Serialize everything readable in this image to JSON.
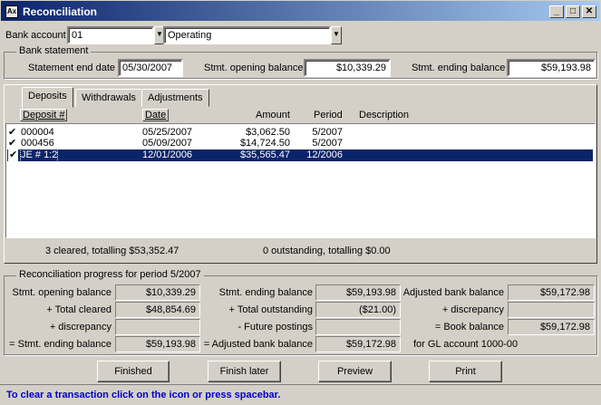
{
  "window": {
    "title": "Reconciliation",
    "icon": "app-icon",
    "icon_text": "Ax",
    "min_glyph": "_",
    "max_glyph": "□",
    "close_glyph": "✕"
  },
  "header": {
    "bank_account_label": "Bank account",
    "bank_account_code": "01",
    "bank_account_name": "Operating",
    "arrow": "▼"
  },
  "bank_statement": {
    "group_title": "Bank statement",
    "end_date_label": "Statement end date",
    "end_date": "05/30/2007",
    "opening_label": "Stmt. opening balance",
    "opening_value": "$10,339.29",
    "ending_label": "Stmt. ending balance",
    "ending_value": "$59,193.98"
  },
  "tabs": [
    {
      "label": "Deposits",
      "active": true
    },
    {
      "label": "Withdrawals",
      "active": false
    },
    {
      "label": "Adjustments",
      "active": false
    }
  ],
  "table": {
    "columns": [
      "Deposit #",
      "Date",
      "Amount",
      "Period",
      "Description"
    ],
    "rows": [
      {
        "check": "✔",
        "deposit": "000004",
        "date": "05/25/2007",
        "amount": "$3,062.50",
        "period": "5/2007",
        "description": "",
        "selected": false
      },
      {
        "check": "✔",
        "deposit": "000456",
        "date": "05/09/2007",
        "amount": "$14,724.50",
        "period": "5/2007",
        "description": "",
        "selected": false
      },
      {
        "check": "✔",
        "deposit": "JE # 1:2",
        "date": "12/01/2006",
        "amount": "$35,565.47",
        "period": "12/2006",
        "description": "",
        "selected": true
      }
    ]
  },
  "summary": {
    "cleared": "3 cleared, totalling $53,352.47",
    "outstanding": "0 outstanding, totalling $0.00"
  },
  "progress": {
    "group_title": "Reconciliation progress for period  5/2007",
    "col1": [
      {
        "label": "Stmt. opening balance",
        "value": "$10,339.29"
      },
      {
        "label": "+ Total cleared",
        "value": "$48,854.69"
      },
      {
        "label": "+ discrepancy",
        "value": ""
      },
      {
        "label": "= Stmt. ending balance",
        "value": "$59,193.98"
      }
    ],
    "col2": [
      {
        "label": "Stmt. ending balance",
        "value": "$59,193.98"
      },
      {
        "label": "+ Total outstanding",
        "value": "($21.00)"
      },
      {
        "label": "- Future postings",
        "value": ""
      },
      {
        "label": "= Adjusted bank balance",
        "value": "$59,172.98"
      }
    ],
    "col3": [
      {
        "label": "Adjusted bank balance",
        "value": "$59,172.98"
      },
      {
        "label": "+ discrepancy",
        "value": ""
      },
      {
        "label": "= Book balance",
        "value": "$59,172.98"
      }
    ],
    "gl_note": "for GL account 1000-00"
  },
  "buttons": {
    "finished": "Finished",
    "finish_later": "Finish later",
    "preview": "Preview",
    "print": "Print"
  },
  "status": "To clear a transaction click on the icon or press spacebar."
}
